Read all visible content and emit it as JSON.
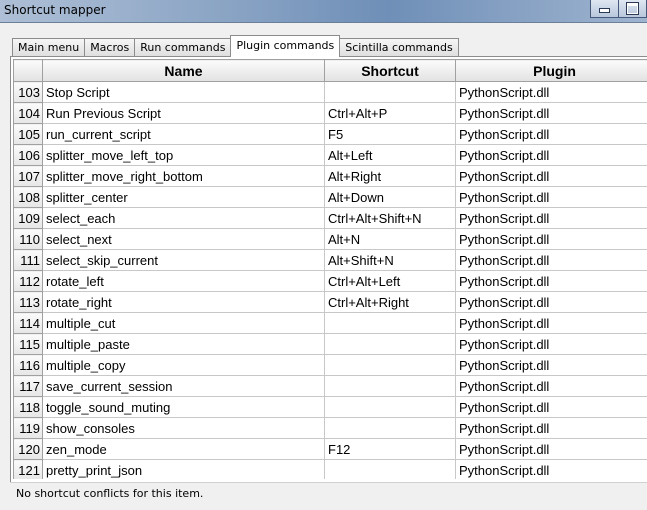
{
  "window": {
    "title": "Shortcut mapper"
  },
  "tabs": [
    "Main menu",
    "Macros",
    "Run commands",
    "Plugin commands",
    "Scintilla commands"
  ],
  "active_tab": "Plugin commands",
  "table": {
    "headers": {
      "num": "",
      "name": "Name",
      "shortcut": "Shortcut",
      "plugin": "Plugin"
    },
    "rows": [
      {
        "num": "103",
        "name": "Stop Script",
        "shortcut": "",
        "plugin": "PythonScript.dll"
      },
      {
        "num": "104",
        "name": "Run Previous Script",
        "shortcut": "Ctrl+Alt+P",
        "plugin": "PythonScript.dll"
      },
      {
        "num": "105",
        "name": "run_current_script",
        "shortcut": "F5",
        "plugin": "PythonScript.dll"
      },
      {
        "num": "106",
        "name": "splitter_move_left_top",
        "shortcut": "Alt+Left",
        "plugin": "PythonScript.dll"
      },
      {
        "num": "107",
        "name": "splitter_move_right_bottom",
        "shortcut": "Alt+Right",
        "plugin": "PythonScript.dll"
      },
      {
        "num": "108",
        "name": "splitter_center",
        "shortcut": "Alt+Down",
        "plugin": "PythonScript.dll"
      },
      {
        "num": "109",
        "name": "select_each",
        "shortcut": "Ctrl+Alt+Shift+N",
        "plugin": "PythonScript.dll"
      },
      {
        "num": "110",
        "name": "select_next",
        "shortcut": "Alt+N",
        "plugin": "PythonScript.dll"
      },
      {
        "num": "111",
        "name": "select_skip_current",
        "shortcut": "Alt+Shift+N",
        "plugin": "PythonScript.dll"
      },
      {
        "num": "112",
        "name": "rotate_left",
        "shortcut": "Ctrl+Alt+Left",
        "plugin": "PythonScript.dll"
      },
      {
        "num": "113",
        "name": "rotate_right",
        "shortcut": "Ctrl+Alt+Right",
        "plugin": "PythonScript.dll"
      },
      {
        "num": "114",
        "name": "multiple_cut",
        "shortcut": "",
        "plugin": "PythonScript.dll"
      },
      {
        "num": "115",
        "name": "multiple_paste",
        "shortcut": "",
        "plugin": "PythonScript.dll"
      },
      {
        "num": "116",
        "name": "multiple_copy",
        "shortcut": "",
        "plugin": "PythonScript.dll"
      },
      {
        "num": "117",
        "name": "save_current_session",
        "shortcut": "",
        "plugin": "PythonScript.dll"
      },
      {
        "num": "118",
        "name": "toggle_sound_muting",
        "shortcut": "",
        "plugin": "PythonScript.dll"
      },
      {
        "num": "119",
        "name": "show_consoles",
        "shortcut": "",
        "plugin": "PythonScript.dll"
      },
      {
        "num": "120",
        "name": "zen_mode",
        "shortcut": "F12",
        "plugin": "PythonScript.dll"
      },
      {
        "num": "121",
        "name": "pretty_print_json",
        "shortcut": "",
        "plugin": "PythonScript.dll"
      }
    ]
  },
  "status": "No shortcut conflicts for this item.",
  "icons": {
    "minimize": "minimize-icon",
    "maximize": "maximize-icon"
  }
}
